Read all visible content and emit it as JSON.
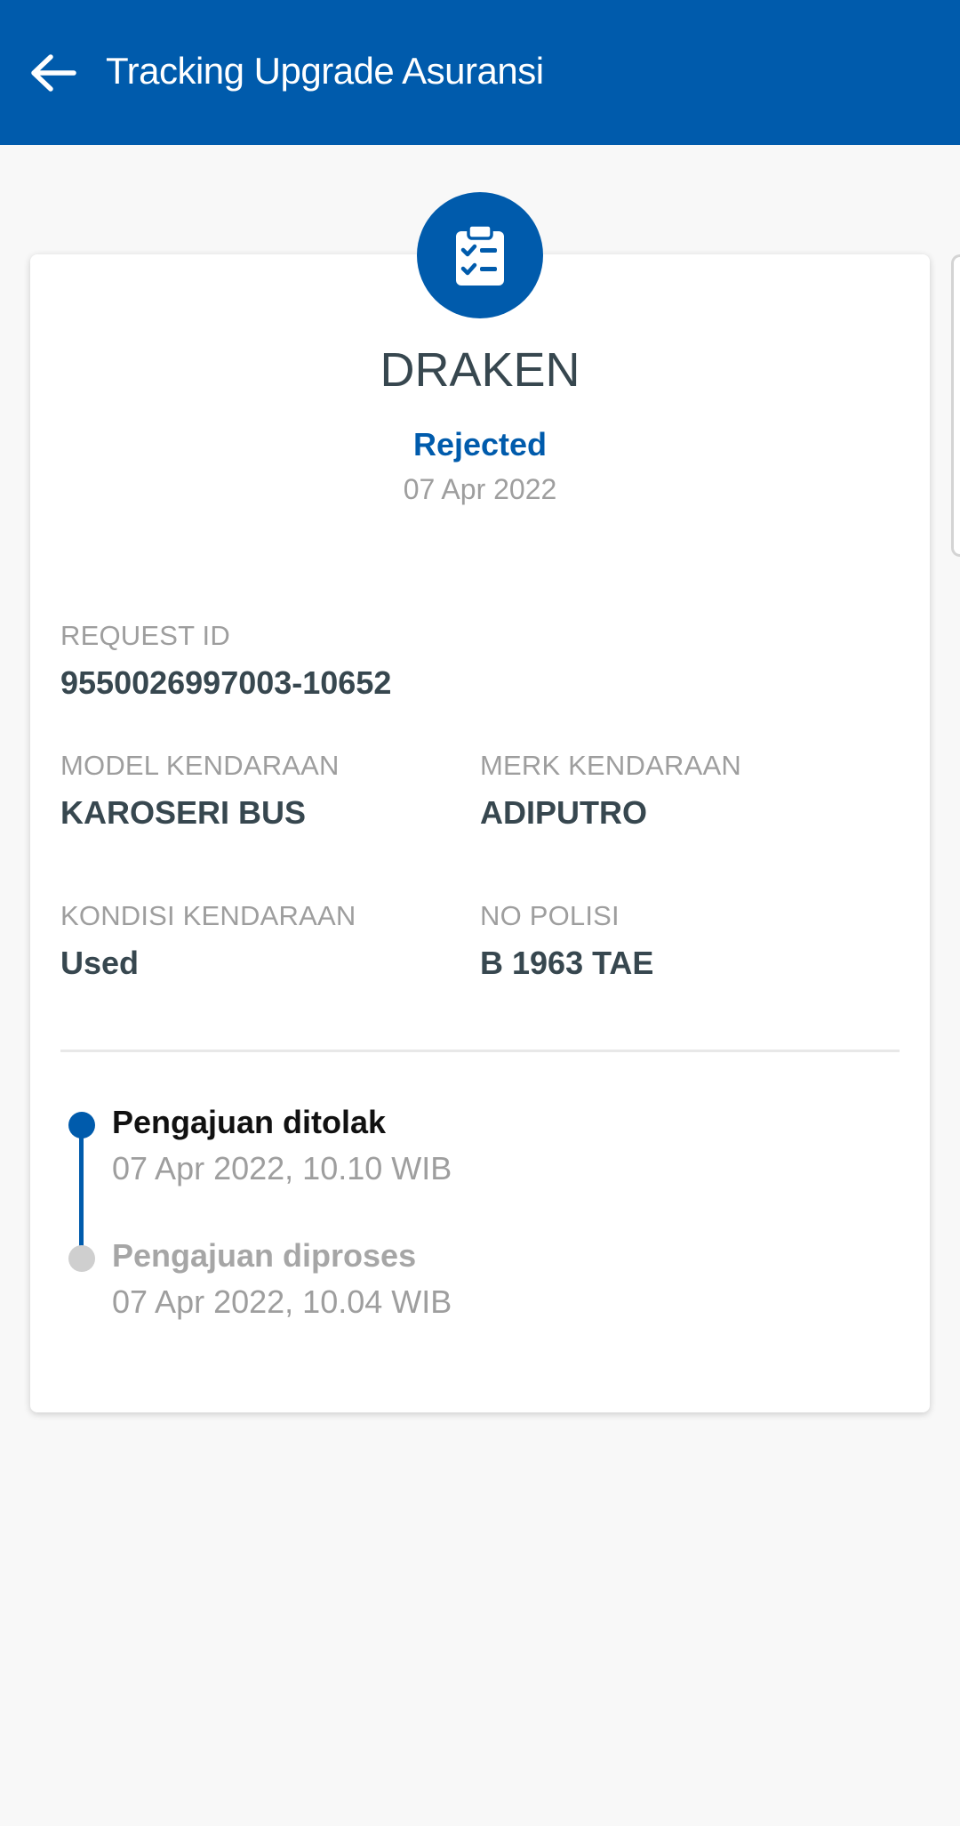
{
  "header": {
    "title": "Tracking Upgrade Asuransi",
    "background_color": "#005bac",
    "back_icon": "arrow-left-icon"
  },
  "card": {
    "icon": "clipboard-check-icon",
    "name": "DRAKEN",
    "status": "Rejected",
    "status_color": "#005bac",
    "date": "07 Apr 2022",
    "fields": {
      "request_id_label": "REQUEST ID",
      "request_id_value": "9550026997003-10652",
      "model_label": "MODEL KENDARAAN",
      "model_value": "KAROSERI BUS",
      "merk_label": "MERK KENDARAAN",
      "merk_value": "ADIPUTRO",
      "kondisi_label": "KONDISI KENDARAAN",
      "kondisi_value": "Used",
      "polisi_label": "NO POLISI",
      "polisi_value": "B 1963 TAE"
    },
    "timeline": [
      {
        "title": "Pengajuan ditolak",
        "time": "07 Apr 2022, 10.10 WIB",
        "active": true
      },
      {
        "title": "Pengajuan diproses",
        "time": "07 Apr 2022, 10.04 WIB",
        "active": false
      }
    ]
  }
}
